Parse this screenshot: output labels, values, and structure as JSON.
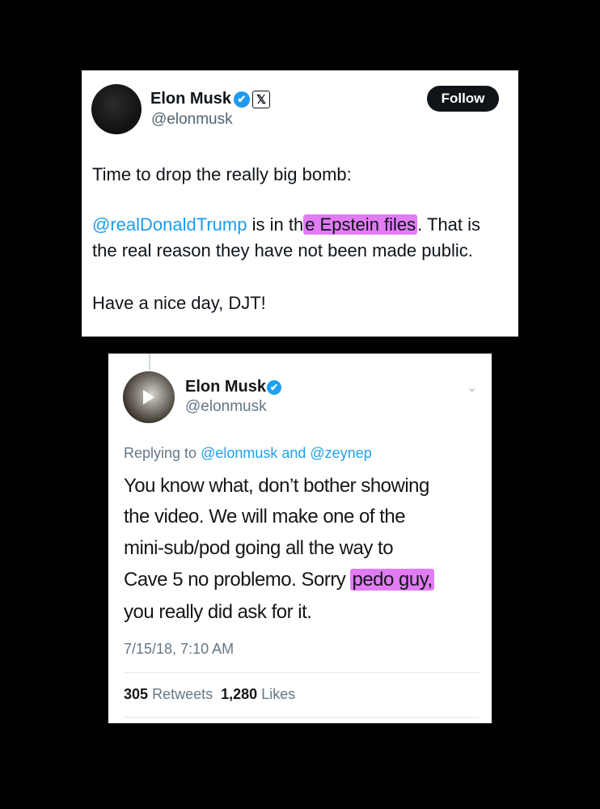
{
  "tweet1": {
    "name": "Elon Musk",
    "verified_icon": "✔",
    "x_icon": "𝕏",
    "handle": "@elonmusk",
    "follow_label": "Follow",
    "line1": "Time to drop the really big bomb:",
    "line2_mention": "@realDonaldTrump",
    "line2_mid": " is in th",
    "line2_hl_a": "e ",
    "line2_hl": "Epstein files",
    "line2_end": ". That is",
    "line3": "the real reason they have not been made public.",
    "line4": "Have a nice day, DJT!"
  },
  "tweet2": {
    "name": "Elon Musk",
    "verified_icon": "✔",
    "handle": "@elonmusk",
    "chevron": "⌄",
    "reply_prefix": "Replying to ",
    "reply_mentions": "@elonmusk and @zeynep",
    "l1": "You know what, don’t bother showing",
    "l2": "the video. We will make one of the",
    "l3": "mini-sub/pod going all the way to",
    "l4a": "Cave 5 no problemo. Sorry ",
    "l4hl": "pedo guy,",
    "l5": "you really did ask for it.",
    "timestamp": "7/15/18, 7:10 AM",
    "retweets_count": "305",
    "retweets_label": "Retweets",
    "likes_count": "1,280",
    "likes_label": "Likes"
  },
  "colors": {
    "highlight": "#e27cf5",
    "mention": "#1d9bf0",
    "background": "#000000"
  }
}
